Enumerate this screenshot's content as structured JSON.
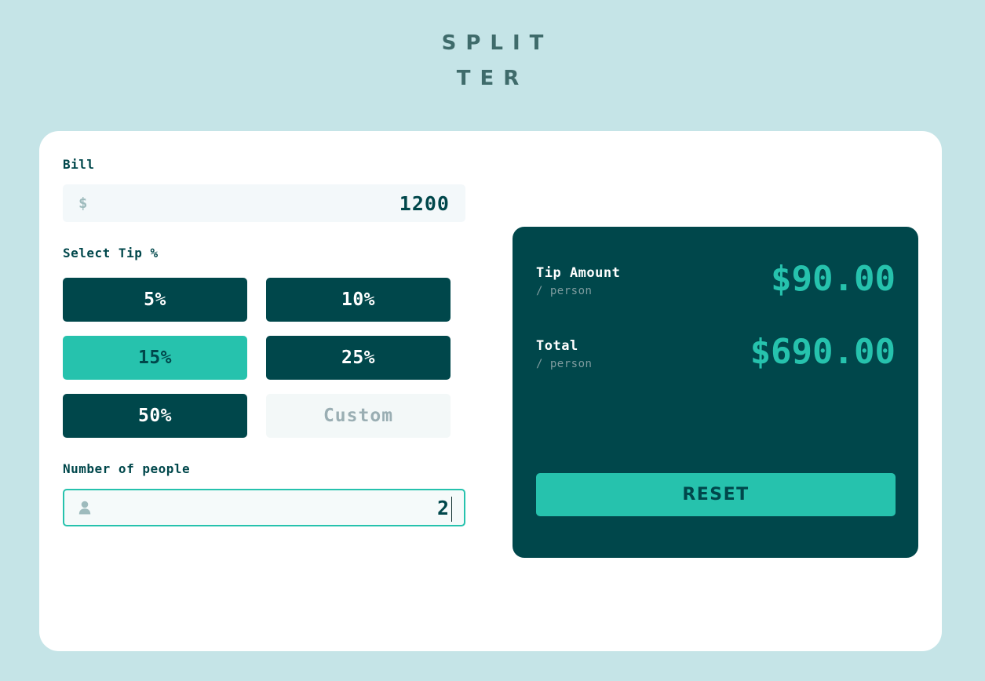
{
  "app": {
    "title": "SPLITTER"
  },
  "bill": {
    "label": "Bill",
    "icon": "dollar-icon",
    "value": "1200",
    "placeholder": "0"
  },
  "tip": {
    "label": "Select Tip %",
    "options": [
      {
        "label": "5%",
        "value": 5,
        "selected": false
      },
      {
        "label": "10%",
        "value": 10,
        "selected": false
      },
      {
        "label": "15%",
        "value": 15,
        "selected": true
      },
      {
        "label": "25%",
        "value": 25,
        "selected": false
      },
      {
        "label": "50%",
        "value": 50,
        "selected": false
      }
    ],
    "custom_placeholder": "Custom",
    "custom_value": ""
  },
  "people": {
    "label": "Number of people",
    "icon": "person-icon",
    "value": "2",
    "placeholder": "0",
    "focused": true
  },
  "results": {
    "rows": [
      {
        "title": "Tip Amount",
        "subtitle": "/ person",
        "amount": "$90.00"
      },
      {
        "title": "Total",
        "subtitle": "/ person",
        "amount": "$690.00"
      }
    ],
    "reset_label": "RESET"
  },
  "colors": {
    "background": "#c5e4e7",
    "card": "#ffffff",
    "panel_dark": "#00474b",
    "accent": "#26c2ad",
    "input_bg": "#f3f8fa",
    "muted_text": "#7f9c9f",
    "title_text": "#3f6b6b"
  }
}
